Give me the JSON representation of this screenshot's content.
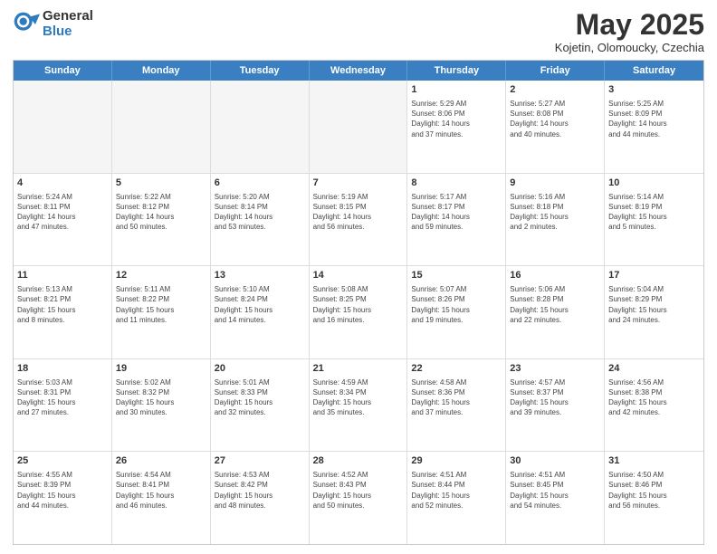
{
  "header": {
    "logo_general": "General",
    "logo_blue": "Blue",
    "month_title": "May 2025",
    "subtitle": "Kojetin, Olomoucky, Czechia"
  },
  "days_of_week": [
    "Sunday",
    "Monday",
    "Tuesday",
    "Wednesday",
    "Thursday",
    "Friday",
    "Saturday"
  ],
  "rows": [
    [
      {
        "day": "",
        "text": "",
        "empty": true
      },
      {
        "day": "",
        "text": "",
        "empty": true
      },
      {
        "day": "",
        "text": "",
        "empty": true
      },
      {
        "day": "",
        "text": "",
        "empty": true
      },
      {
        "day": "1",
        "text": "Sunrise: 5:29 AM\nSunset: 8:06 PM\nDaylight: 14 hours\nand 37 minutes.",
        "empty": false
      },
      {
        "day": "2",
        "text": "Sunrise: 5:27 AM\nSunset: 8:08 PM\nDaylight: 14 hours\nand 40 minutes.",
        "empty": false
      },
      {
        "day": "3",
        "text": "Sunrise: 5:25 AM\nSunset: 8:09 PM\nDaylight: 14 hours\nand 44 minutes.",
        "empty": false
      }
    ],
    [
      {
        "day": "4",
        "text": "Sunrise: 5:24 AM\nSunset: 8:11 PM\nDaylight: 14 hours\nand 47 minutes.",
        "empty": false
      },
      {
        "day": "5",
        "text": "Sunrise: 5:22 AM\nSunset: 8:12 PM\nDaylight: 14 hours\nand 50 minutes.",
        "empty": false
      },
      {
        "day": "6",
        "text": "Sunrise: 5:20 AM\nSunset: 8:14 PM\nDaylight: 14 hours\nand 53 minutes.",
        "empty": false
      },
      {
        "day": "7",
        "text": "Sunrise: 5:19 AM\nSunset: 8:15 PM\nDaylight: 14 hours\nand 56 minutes.",
        "empty": false
      },
      {
        "day": "8",
        "text": "Sunrise: 5:17 AM\nSunset: 8:17 PM\nDaylight: 14 hours\nand 59 minutes.",
        "empty": false
      },
      {
        "day": "9",
        "text": "Sunrise: 5:16 AM\nSunset: 8:18 PM\nDaylight: 15 hours\nand 2 minutes.",
        "empty": false
      },
      {
        "day": "10",
        "text": "Sunrise: 5:14 AM\nSunset: 8:19 PM\nDaylight: 15 hours\nand 5 minutes.",
        "empty": false
      }
    ],
    [
      {
        "day": "11",
        "text": "Sunrise: 5:13 AM\nSunset: 8:21 PM\nDaylight: 15 hours\nand 8 minutes.",
        "empty": false
      },
      {
        "day": "12",
        "text": "Sunrise: 5:11 AM\nSunset: 8:22 PM\nDaylight: 15 hours\nand 11 minutes.",
        "empty": false
      },
      {
        "day": "13",
        "text": "Sunrise: 5:10 AM\nSunset: 8:24 PM\nDaylight: 15 hours\nand 14 minutes.",
        "empty": false
      },
      {
        "day": "14",
        "text": "Sunrise: 5:08 AM\nSunset: 8:25 PM\nDaylight: 15 hours\nand 16 minutes.",
        "empty": false
      },
      {
        "day": "15",
        "text": "Sunrise: 5:07 AM\nSunset: 8:26 PM\nDaylight: 15 hours\nand 19 minutes.",
        "empty": false
      },
      {
        "day": "16",
        "text": "Sunrise: 5:06 AM\nSunset: 8:28 PM\nDaylight: 15 hours\nand 22 minutes.",
        "empty": false
      },
      {
        "day": "17",
        "text": "Sunrise: 5:04 AM\nSunset: 8:29 PM\nDaylight: 15 hours\nand 24 minutes.",
        "empty": false
      }
    ],
    [
      {
        "day": "18",
        "text": "Sunrise: 5:03 AM\nSunset: 8:31 PM\nDaylight: 15 hours\nand 27 minutes.",
        "empty": false
      },
      {
        "day": "19",
        "text": "Sunrise: 5:02 AM\nSunset: 8:32 PM\nDaylight: 15 hours\nand 30 minutes.",
        "empty": false
      },
      {
        "day": "20",
        "text": "Sunrise: 5:01 AM\nSunset: 8:33 PM\nDaylight: 15 hours\nand 32 minutes.",
        "empty": false
      },
      {
        "day": "21",
        "text": "Sunrise: 4:59 AM\nSunset: 8:34 PM\nDaylight: 15 hours\nand 35 minutes.",
        "empty": false
      },
      {
        "day": "22",
        "text": "Sunrise: 4:58 AM\nSunset: 8:36 PM\nDaylight: 15 hours\nand 37 minutes.",
        "empty": false
      },
      {
        "day": "23",
        "text": "Sunrise: 4:57 AM\nSunset: 8:37 PM\nDaylight: 15 hours\nand 39 minutes.",
        "empty": false
      },
      {
        "day": "24",
        "text": "Sunrise: 4:56 AM\nSunset: 8:38 PM\nDaylight: 15 hours\nand 42 minutes.",
        "empty": false
      }
    ],
    [
      {
        "day": "25",
        "text": "Sunrise: 4:55 AM\nSunset: 8:39 PM\nDaylight: 15 hours\nand 44 minutes.",
        "empty": false
      },
      {
        "day": "26",
        "text": "Sunrise: 4:54 AM\nSunset: 8:41 PM\nDaylight: 15 hours\nand 46 minutes.",
        "empty": false
      },
      {
        "day": "27",
        "text": "Sunrise: 4:53 AM\nSunset: 8:42 PM\nDaylight: 15 hours\nand 48 minutes.",
        "empty": false
      },
      {
        "day": "28",
        "text": "Sunrise: 4:52 AM\nSunset: 8:43 PM\nDaylight: 15 hours\nand 50 minutes.",
        "empty": false
      },
      {
        "day": "29",
        "text": "Sunrise: 4:51 AM\nSunset: 8:44 PM\nDaylight: 15 hours\nand 52 minutes.",
        "empty": false
      },
      {
        "day": "30",
        "text": "Sunrise: 4:51 AM\nSunset: 8:45 PM\nDaylight: 15 hours\nand 54 minutes.",
        "empty": false
      },
      {
        "day": "31",
        "text": "Sunrise: 4:50 AM\nSunset: 8:46 PM\nDaylight: 15 hours\nand 56 minutes.",
        "empty": false
      }
    ]
  ]
}
